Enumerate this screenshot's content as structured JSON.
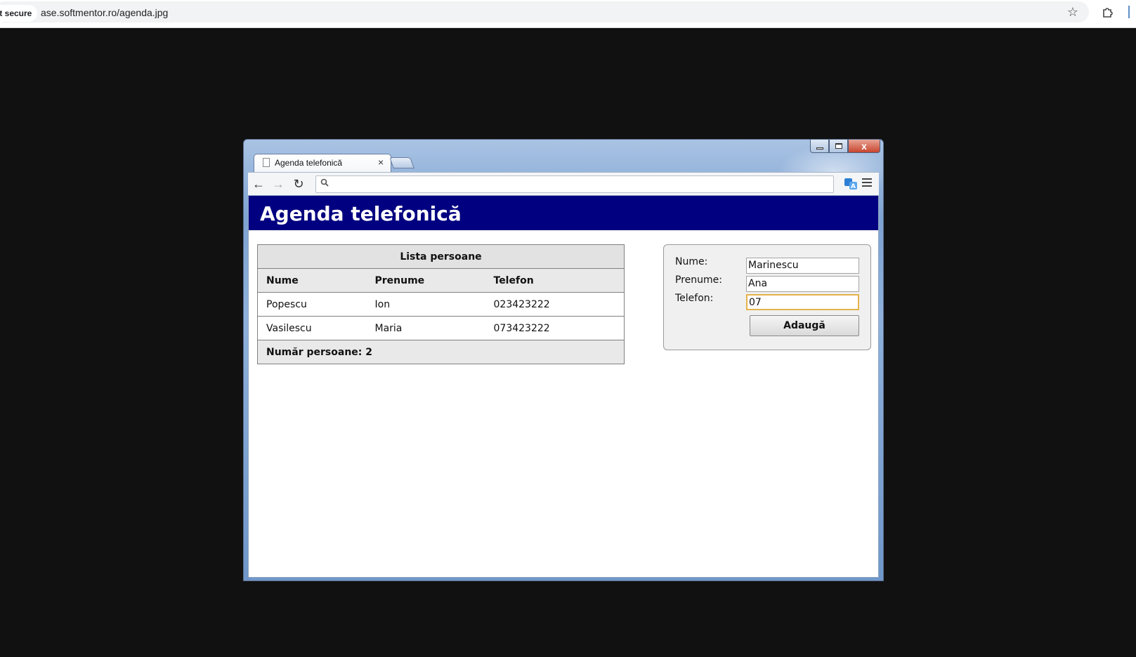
{
  "outer_browser": {
    "security_label": "ot secure",
    "url": "ase.softmentor.ro/agenda.jpg",
    "icons": [
      "star-icon",
      "extensions-icon"
    ]
  },
  "inner_browser": {
    "tab_title": "Agenda telefonică",
    "tab_close": "×",
    "window_controls": {
      "close": "x"
    },
    "nav": {
      "back": "←",
      "forward": "→",
      "reload": "↻"
    },
    "omnibox": {
      "value": "",
      "search_glyph": "⚲"
    }
  },
  "app": {
    "title": "Agenda telefonică",
    "list": {
      "caption": "Lista persoane",
      "columns": [
        "Nume",
        "Prenume",
        "Telefon"
      ],
      "rows": [
        [
          "Popescu",
          "Ion",
          "023423222"
        ],
        [
          "Vasilescu",
          "Maria",
          "073423222"
        ]
      ],
      "footer": "Număr persoane: 2"
    },
    "form": {
      "nume_label": "Nume:",
      "nume_value": "Marinescu",
      "prenume_label": "Prenume:",
      "prenume_value": "Ana",
      "telefon_label": "Telefon:",
      "telefon_value": "07",
      "submit_label": "Adaugă"
    }
  },
  "colors": {
    "header_bg": "#000080",
    "page_bg": "#111111",
    "focus_border": "#e4b34b"
  }
}
